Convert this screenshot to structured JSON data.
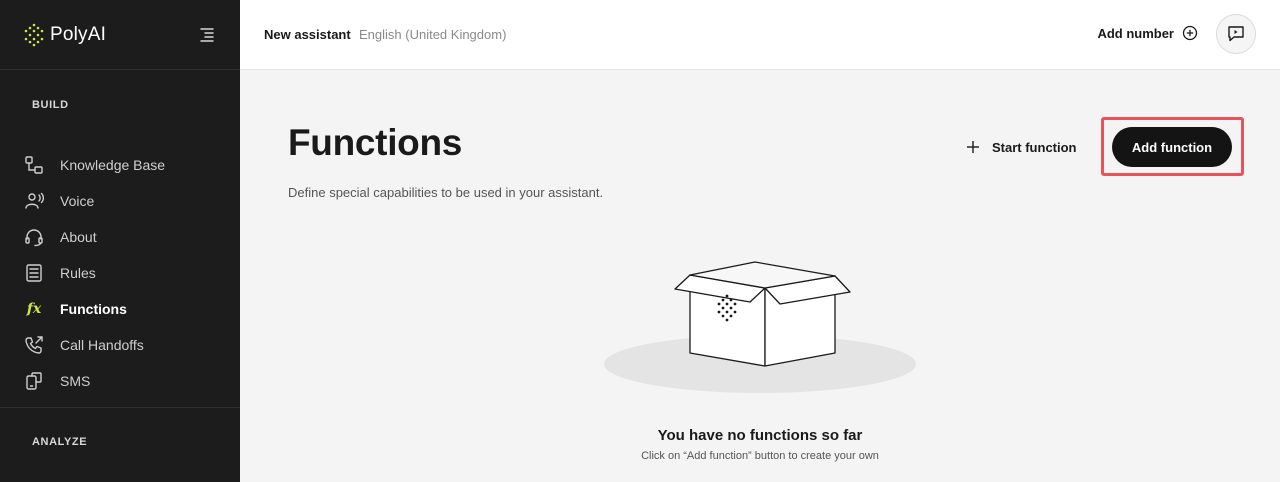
{
  "brand": {
    "name": "PolyAI",
    "logo_icon": "polyai-dots-logo",
    "accent": "#c9e84a"
  },
  "sidebar": {
    "build_label": "BUILD",
    "analyze_label": "ANALYZE",
    "items": [
      {
        "label": "Knowledge Base",
        "icon": "knowledge-base-icon",
        "active": false
      },
      {
        "label": "Voice",
        "icon": "voice-icon",
        "active": false
      },
      {
        "label": "About",
        "icon": "headset-icon",
        "active": false
      },
      {
        "label": "Rules",
        "icon": "rules-icon",
        "active": false
      },
      {
        "label": "Functions",
        "icon": "fx-icon",
        "icon_text": "fx",
        "active": true
      },
      {
        "label": "Call Handoffs",
        "icon": "phone-forward-icon",
        "active": false
      },
      {
        "label": "SMS",
        "icon": "sms-icon",
        "active": false
      }
    ]
  },
  "header": {
    "assistant_name": "New assistant",
    "language": "English (United Kingdom)",
    "add_number_label": "Add number",
    "chat_icon": "chat-bubble-icon"
  },
  "main": {
    "title": "Functions",
    "description": "Define special capabilities to be used in your assistant.",
    "start_function_label": "Start function",
    "add_function_label": "Add function",
    "empty_title": "You have no functions so far",
    "empty_subtitle": "Click on “Add function” button to create your own"
  },
  "colors": {
    "sidebar_bg": "#1c1c1c",
    "highlight": "#e8525a",
    "primary_button": "#141414"
  }
}
